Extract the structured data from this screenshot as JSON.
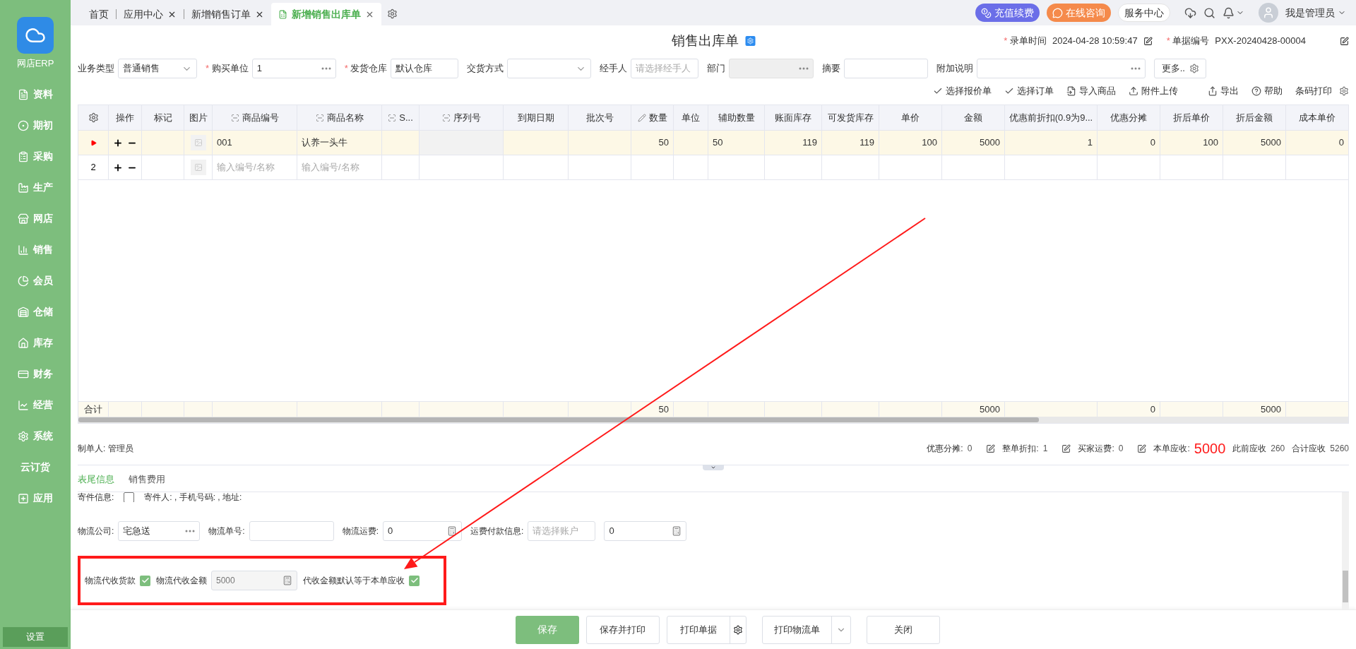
{
  "sidebar": {
    "app_name": "网店ERP",
    "items": [
      {
        "label": "资料"
      },
      {
        "label": "期初"
      },
      {
        "label": "采购"
      },
      {
        "label": "生产"
      },
      {
        "label": "网店"
      },
      {
        "label": "销售"
      },
      {
        "label": "会员"
      },
      {
        "label": "仓储"
      },
      {
        "label": "库存"
      },
      {
        "label": "财务"
      },
      {
        "label": "经营"
      },
      {
        "label": "系统"
      },
      {
        "label": "云订货"
      },
      {
        "label": "应用"
      }
    ],
    "footer": "设置"
  },
  "tabs": [
    {
      "label": "首页",
      "selected": false,
      "closable": false
    },
    {
      "label": "应用中心",
      "selected": false,
      "closable": true
    },
    {
      "label": "新增销售订单",
      "selected": false,
      "closable": true
    },
    {
      "label": "新增销售出库单",
      "selected": true,
      "closable": true
    }
  ],
  "top_actions": [
    {
      "label": "充值续费",
      "kind": "recharge"
    },
    {
      "label": "在线咨询",
      "kind": "chat"
    },
    {
      "label": "服务中心",
      "kind": "plain"
    }
  ],
  "user": {
    "name": "我是管理员"
  },
  "document": {
    "title": "销售出库单",
    "meta": [
      {
        "mark": "*",
        "label": "录单时间",
        "value": "2024-04-28 10:59:47"
      },
      {
        "mark": "*",
        "label": "单据编号",
        "value": "PXX-20240428-00004"
      }
    ]
  },
  "filters": [
    {
      "label": "业务类型",
      "kind": "select",
      "value": "普通销售"
    },
    {
      "mark": "*",
      "label": "购买单位",
      "required": true,
      "kind": "lookup",
      "value": "1"
    },
    {
      "mark": "*",
      "label": "发货仓库",
      "required": true,
      "kind": "text",
      "value": "默认仓库"
    },
    {
      "label": "交货方式",
      "kind": "select"
    },
    {
      "label": "经手人",
      "kind": "text",
      "placeholder": "请选择经手人"
    },
    {
      "label": "部门",
      "kind": "lookup",
      "disabled": true
    },
    {
      "label": "摘要",
      "kind": "text"
    },
    {
      "label": "附加说明",
      "kind": "lookup"
    }
  ],
  "more_button": "更多..",
  "toolbar": [
    {
      "label": "选择报价单",
      "kind": "check"
    },
    {
      "label": "选择订单",
      "kind": "check"
    },
    {
      "label": "导入商品",
      "kind": "import"
    },
    {
      "label": "附件上传",
      "kind": "upload"
    },
    {
      "label": "导出",
      "kind": "export"
    },
    {
      "label": "帮助",
      "kind": "help"
    },
    {
      "label": "条码打印",
      "kind": "plain"
    }
  ],
  "table": {
    "columns": [
      {
        "kind": "settings"
      },
      {
        "label": "操作"
      },
      {
        "label": "标记"
      },
      {
        "label": "图片"
      },
      {
        "label": "商品编号",
        "kind": "scan"
      },
      {
        "label": "商品名称",
        "kind": "scan"
      },
      {
        "label": "S...",
        "kind": "scan"
      },
      {
        "label": "序列号",
        "kind": "scan"
      },
      {
        "label": "到期日期"
      },
      {
        "label": "批次号"
      },
      {
        "label": "数量",
        "kind": "edit"
      },
      {
        "label": "单位"
      },
      {
        "label": "辅助数量"
      },
      {
        "label": "账面库存"
      },
      {
        "label": "可发货库存"
      },
      {
        "label": "单价"
      },
      {
        "label": "金额"
      },
      {
        "label": "优惠前折扣(0.9为9..."
      },
      {
        "label": "优惠分摊"
      },
      {
        "label": "折后单价"
      },
      {
        "label": "折后金额"
      },
      {
        "label": "成本单价"
      }
    ],
    "rows": [
      {
        "kind": "item",
        "selected": true,
        "cells": [
          "",
          "",
          "",
          "",
          "001",
          "认养一头牛",
          "",
          "",
          "",
          "",
          "50",
          "",
          "50",
          "119",
          "119",
          "100",
          "5000",
          "1",
          "0",
          "100",
          "5000",
          "0"
        ]
      },
      {
        "kind": "item",
        "selected": false,
        "cells": [
          "2",
          "",
          "",
          "",
          {
            "placeholder": "输入编号/名称"
          },
          {
            "placeholder": "输入编号/名称"
          },
          "",
          "",
          "",
          "",
          "",
          "",
          "",
          "",
          "",
          "",
          "",
          "",
          "",
          "",
          "",
          ""
        ]
      },
      {
        "kind": "total",
        "cells": [
          "合计",
          "",
          "",
          "",
          "",
          "",
          "",
          "",
          "",
          "",
          "50",
          "",
          "",
          "",
          "",
          "",
          "5000",
          "",
          "0",
          "",
          "5000",
          ""
        ]
      }
    ]
  },
  "maker": {
    "label": "制单人:",
    "value": "管理员"
  },
  "summary": [
    {
      "label": "优惠分摊:",
      "value": "0",
      "kind": "editable"
    },
    {
      "label": "整单折扣:",
      "value": "1",
      "kind": "editable"
    },
    {
      "label": "买家运费:",
      "value": "0",
      "kind": "editable"
    },
    {
      "label": "本单应收:",
      "value": "5000",
      "kind": "highlight"
    },
    {
      "label": "此前应收",
      "value": "260",
      "kind": "plain"
    },
    {
      "label": "合计应收",
      "value": "5260",
      "kind": "plain"
    }
  ],
  "footer_tabs": [
    {
      "label": "表尾信息",
      "selected": true
    },
    {
      "label": "销售费用",
      "selected": false
    }
  ],
  "sender": {
    "label": "寄件信息:",
    "checked": false,
    "text": "寄件人: , 手机号码: , 地址:"
  },
  "logistics": [
    {
      "label": "物流公司:",
      "kind": "lookup",
      "value": "宅急送"
    },
    {
      "label": "物流单号:",
      "kind": "text"
    },
    {
      "label": "物流运费:",
      "kind": "number",
      "value": "0"
    },
    {
      "label": "运费付款信息:",
      "kind": "text",
      "placeholder": "请选择账户"
    },
    {
      "kind": "number",
      "value": "0"
    }
  ],
  "collection": [
    {
      "kind": "checkbox",
      "label": "物流代收货款",
      "checked": true
    },
    {
      "kind": "number",
      "label": "物流代收金额",
      "value": "5000",
      "disabled": true
    },
    {
      "kind": "checkbox",
      "label": "代收金额默认等于本单应收",
      "checked": true
    }
  ],
  "buttons": [
    {
      "label": "保存",
      "kind": "primary"
    },
    {
      "label": "保存并打印",
      "kind": "plain"
    },
    {
      "label": "打印单据",
      "kind": "settings"
    },
    {
      "label": "打印物流单",
      "kind": "dropdown"
    },
    {
      "label": "关闭",
      "kind": "plain"
    }
  ]
}
